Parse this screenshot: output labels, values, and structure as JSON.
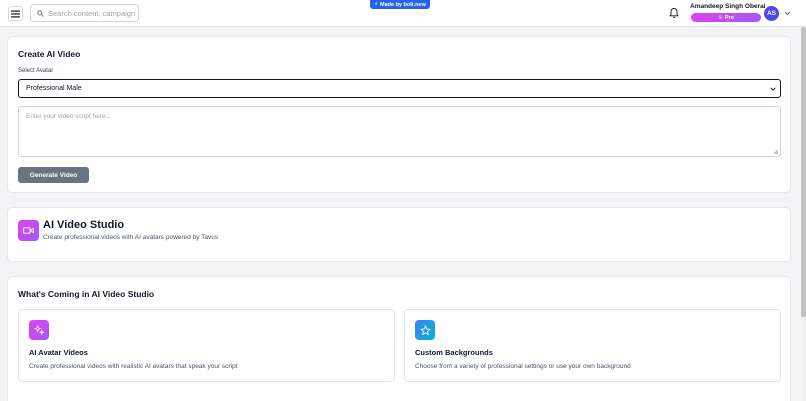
{
  "header": {
    "search_placeholder": "Search content, campaign",
    "bolt_badge": "Made by bolt.new",
    "user_name": "Amandeep Singh Oberai",
    "plan_badge": "Pro",
    "avatar_initials": "AS"
  },
  "create_card": {
    "title": "Create AI Video",
    "avatar_label": "Select Avatar",
    "avatar_selected": "Professional Male",
    "script_placeholder": "Enter your video script here...",
    "generate_button": "Generate Video"
  },
  "studio_card": {
    "title": "AI Video Studio",
    "subtitle": "Create professional videos with AI avatars powered by Tavus"
  },
  "coming_card": {
    "title": "What's Coming in AI Video Studio",
    "features": [
      {
        "icon": "sparkles-icon",
        "title": "AI Avatar Videos",
        "description": "Create professional videos with realistic AI avatars that speak your script"
      },
      {
        "icon": "star-icon",
        "title": "Custom Backgrounds",
        "description": "Choose from a variety of professional settings or use your own background"
      }
    ]
  },
  "colors": {
    "accent_pink": "#d946ef",
    "accent_purple": "#a855f7",
    "accent_blue": "#3b82f6",
    "button_gray": "#6b7280",
    "avatar_indigo": "#4f46e5"
  }
}
